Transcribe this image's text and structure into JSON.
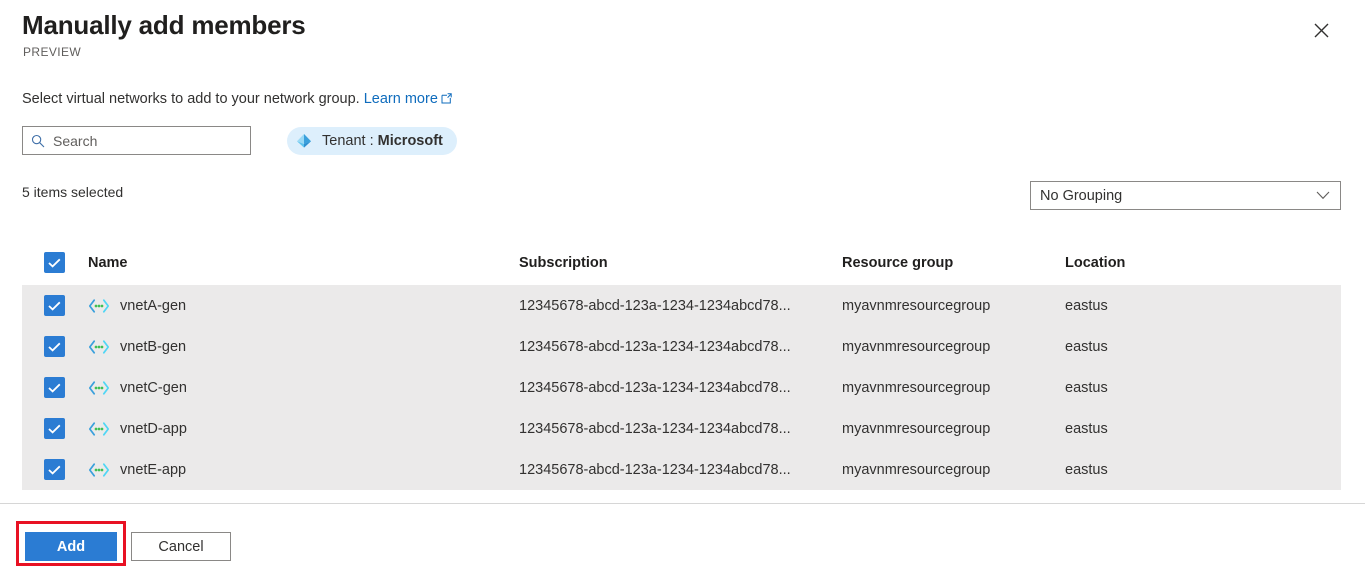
{
  "header": {
    "title": "Manually add members",
    "preview_badge": "PREVIEW",
    "close_icon": "close-icon"
  },
  "description": {
    "text": "Select virtual networks to add to your network group.",
    "link_label": "Learn more",
    "link_icon": "external-link-icon"
  },
  "search": {
    "placeholder": "Search",
    "value": "",
    "icon": "search-icon"
  },
  "tenant_filter": {
    "icon": "tenant-icon",
    "prefix": "Tenant : ",
    "value": "Microsoft"
  },
  "toolbar": {
    "selection_summary": "5 items selected",
    "grouping_value": "No Grouping",
    "grouping_chevron": "chevron-down-icon"
  },
  "table": {
    "select_all_checked": true,
    "columns": [
      "Name",
      "Subscription",
      "Resource group",
      "Location"
    ],
    "rows": [
      {
        "checked": true,
        "icon": "virtual-network-icon",
        "name": "vnetA-gen",
        "subscription": "12345678-abcd-123a-1234-1234abcd78...",
        "resource_group": "myavnmresourcegroup",
        "location": "eastus"
      },
      {
        "checked": true,
        "icon": "virtual-network-icon",
        "name": "vnetB-gen",
        "subscription": "12345678-abcd-123a-1234-1234abcd78...",
        "resource_group": "myavnmresourcegroup",
        "location": "eastus"
      },
      {
        "checked": true,
        "icon": "virtual-network-icon",
        "name": "vnetC-gen",
        "subscription": "12345678-abcd-123a-1234-1234abcd78...",
        "resource_group": "myavnmresourcegroup",
        "location": "eastus"
      },
      {
        "checked": true,
        "icon": "virtual-network-icon",
        "name": "vnetD-app",
        "subscription": "12345678-abcd-123a-1234-1234abcd78...",
        "resource_group": "myavnmresourcegroup",
        "location": "eastus"
      },
      {
        "checked": true,
        "icon": "virtual-network-icon",
        "name": "vnetE-app",
        "subscription": "12345678-abcd-123a-1234-1234abcd78...",
        "resource_group": "myavnmresourcegroup",
        "location": "eastus"
      }
    ]
  },
  "footer": {
    "add_label": "Add",
    "cancel_label": "Cancel"
  },
  "colors": {
    "accent": "#2b7cd3",
    "link": "#0f6cbd",
    "row_selected_bg": "#ebeaea",
    "tenant_pill_bg": "#ddeffc",
    "annotation": "#e81123"
  }
}
